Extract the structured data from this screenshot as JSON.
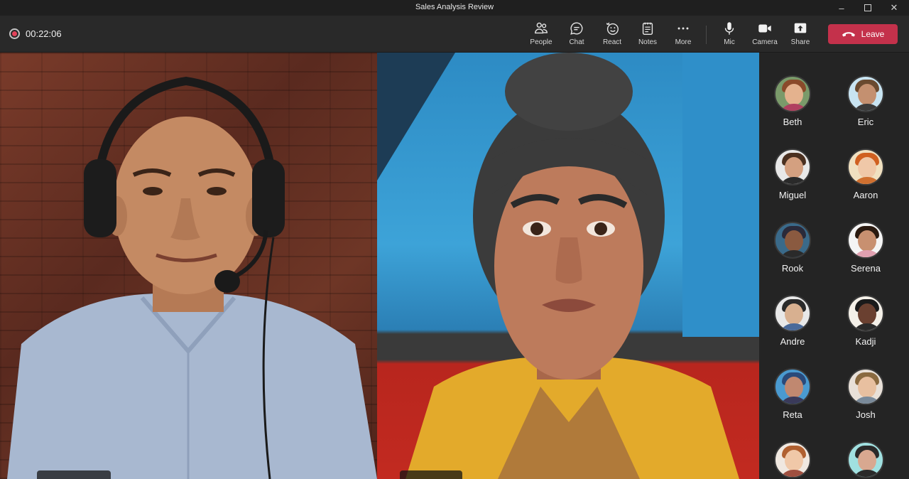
{
  "window": {
    "title": "Sales Analysis Review",
    "controls": [
      "minimize",
      "maximize",
      "close"
    ]
  },
  "toolbar": {
    "recording_time": "00:22:06",
    "buttons": [
      {
        "id": "people",
        "label": "People",
        "icon": "people-icon"
      },
      {
        "id": "chat",
        "label": "Chat",
        "icon": "chat-icon"
      },
      {
        "id": "react",
        "label": "React",
        "icon": "react-icon"
      },
      {
        "id": "notes",
        "label": "Notes",
        "icon": "notes-icon"
      },
      {
        "id": "more",
        "label": "More",
        "icon": "more-icon"
      },
      {
        "id": "mic",
        "label": "Mic",
        "icon": "mic-icon"
      },
      {
        "id": "camera",
        "label": "Camera",
        "icon": "camera-icon"
      },
      {
        "id": "share",
        "label": "Share",
        "icon": "share-icon"
      }
    ],
    "leave_label": "Leave",
    "leave_color": "#c4314b"
  },
  "participants": [
    {
      "name": "Beth"
    },
    {
      "name": "Eric"
    },
    {
      "name": "Miguel"
    },
    {
      "name": "Aaron"
    },
    {
      "name": "Rook"
    },
    {
      "name": "Serena"
    },
    {
      "name": "Andre"
    },
    {
      "name": "Kadji"
    },
    {
      "name": "Reta"
    },
    {
      "name": "Josh"
    },
    {
      "name": ""
    },
    {
      "name": ""
    }
  ]
}
